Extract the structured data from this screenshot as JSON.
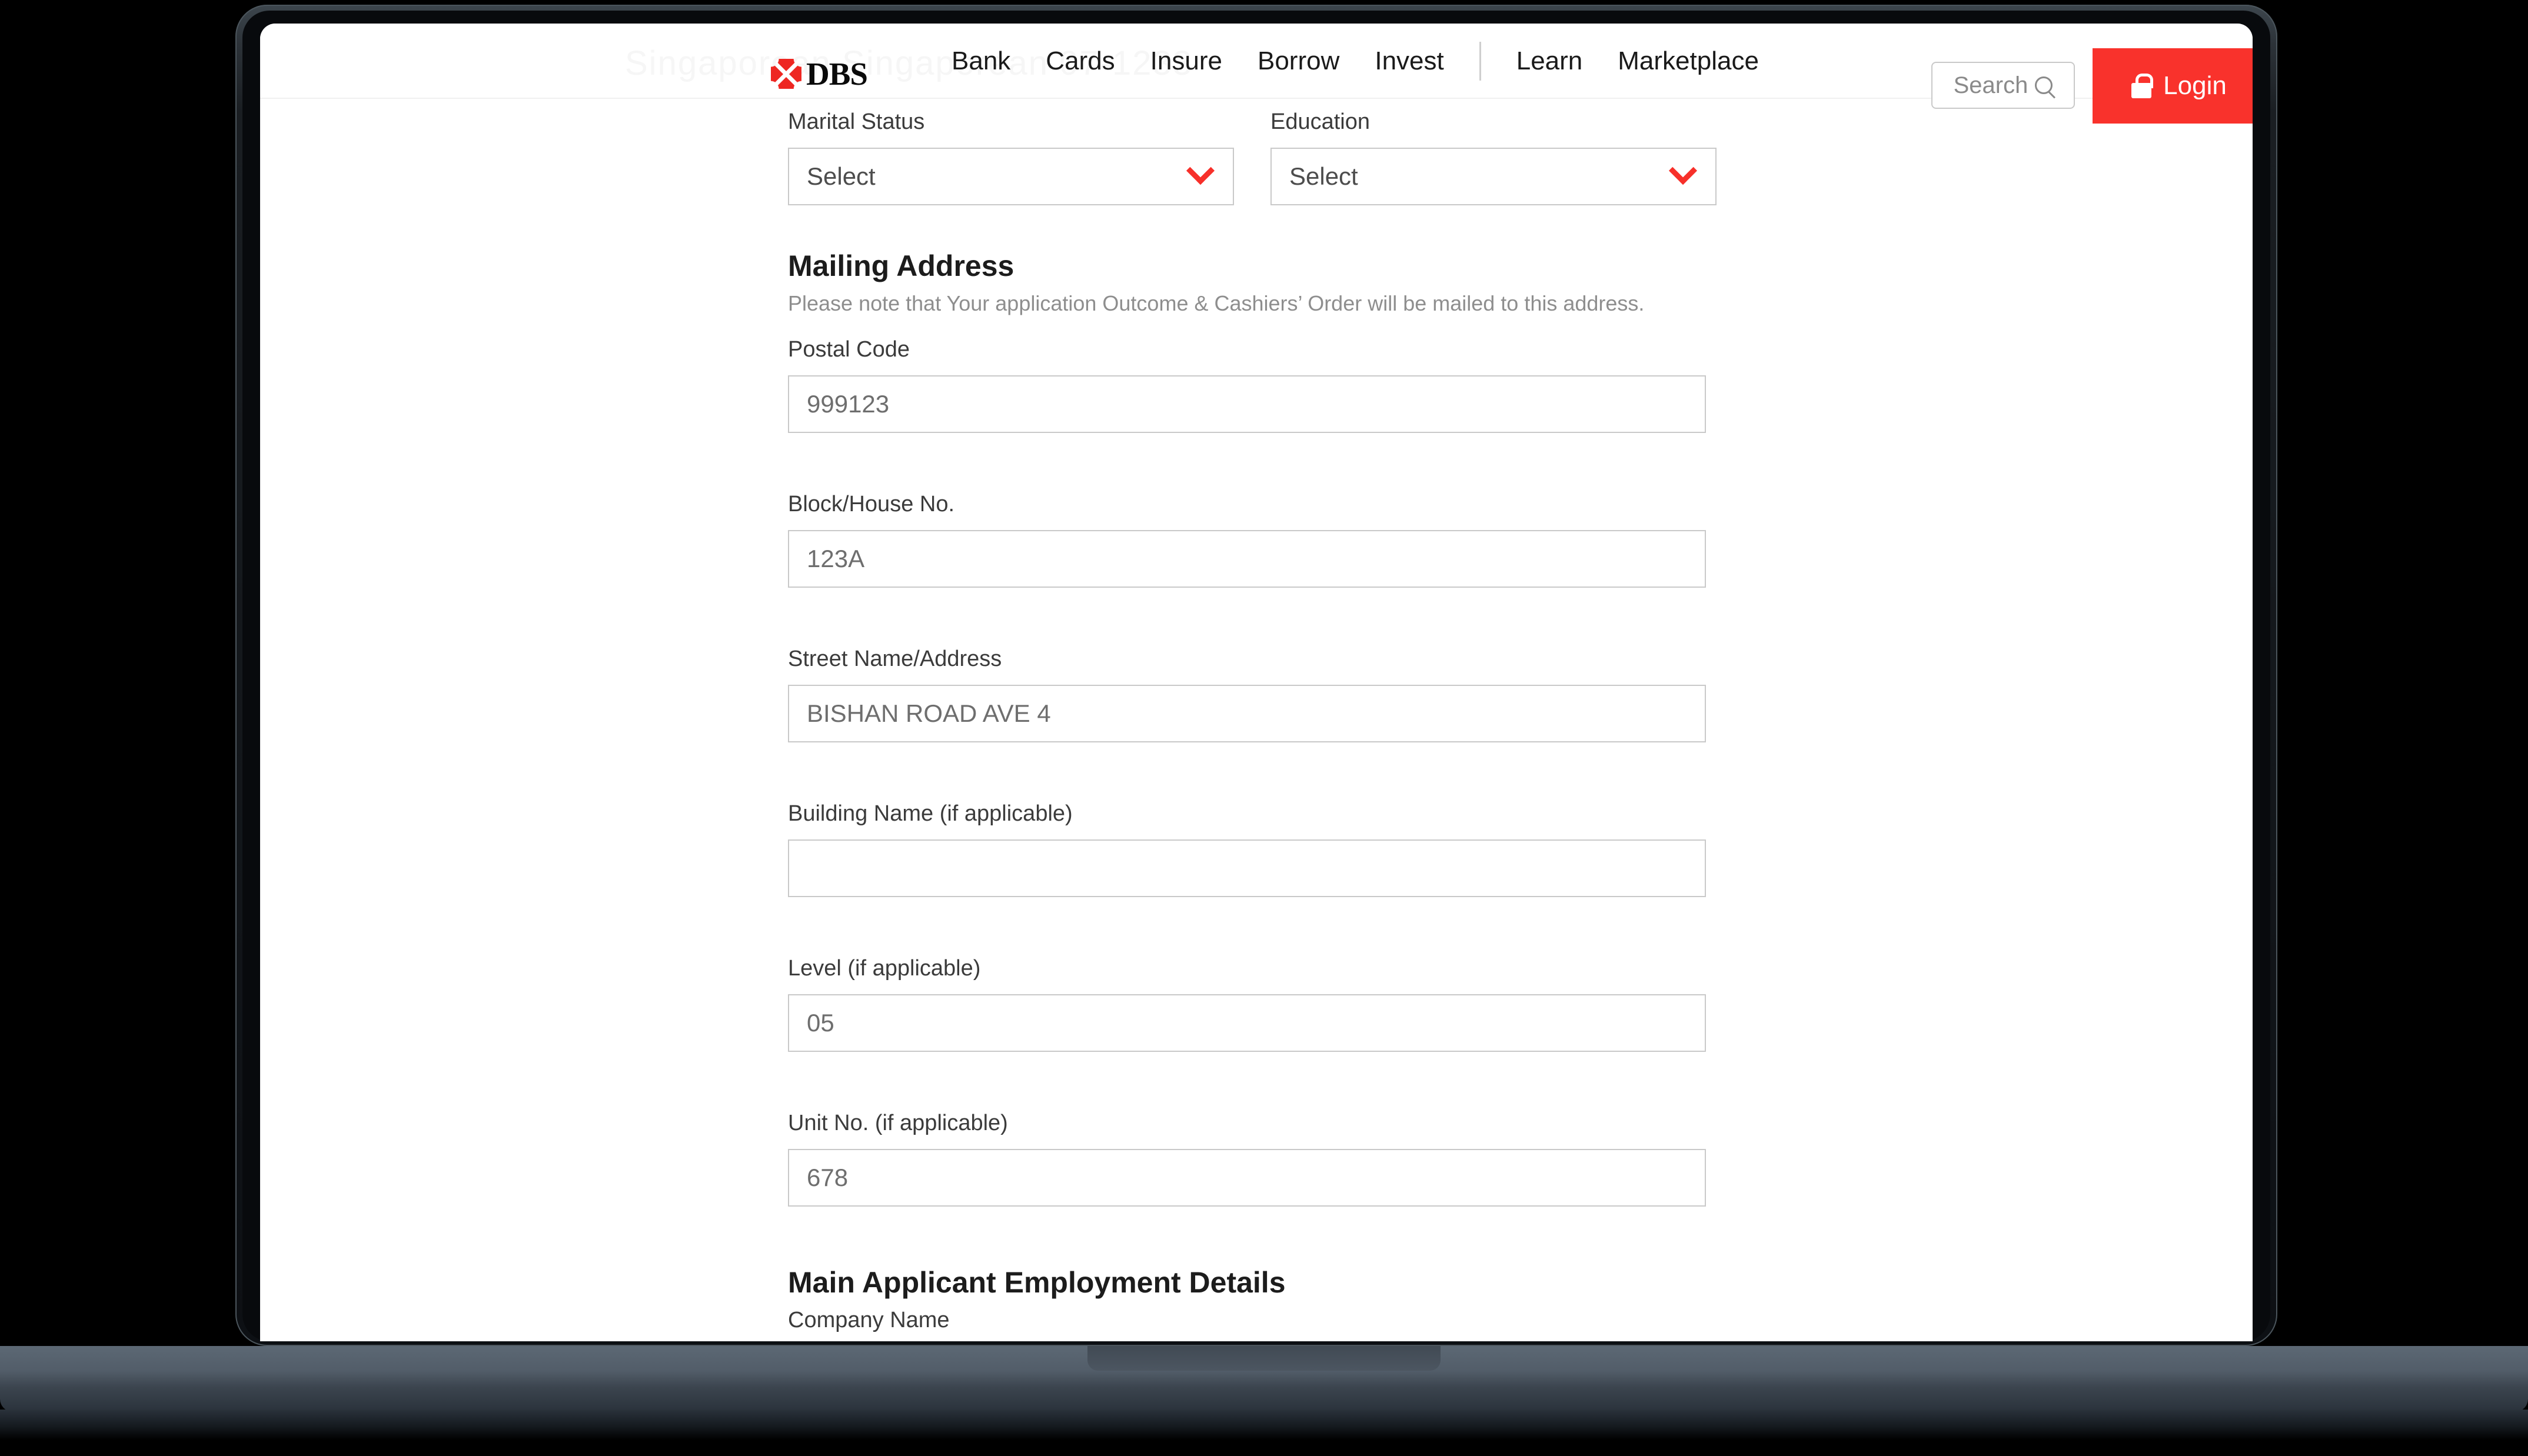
{
  "header": {
    "brand_name": "DBS",
    "watermark_text": "Singaporean    Singaporean    07-1233",
    "nav_items": [
      {
        "label": "Bank"
      },
      {
        "label": "Cards"
      },
      {
        "label": "Insure"
      },
      {
        "label": "Borrow"
      },
      {
        "label": "Invest"
      },
      {
        "label": "Learn"
      },
      {
        "label": "Marketplace"
      }
    ],
    "search": {
      "label": "Search",
      "icon": "search-icon"
    },
    "login": {
      "label": "Login",
      "icon": "lock-icon",
      "color": "#f9322c"
    }
  },
  "form": {
    "marital_status": {
      "label": "Marital Status",
      "value": "Select",
      "icon": "chevron-down-icon"
    },
    "education": {
      "label": "Education",
      "value": "Select",
      "icon": "chevron-down-icon"
    },
    "mailing_address": {
      "heading": "Mailing Address",
      "note": "Please note that Your application Outcome & Cashiers’ Order will be mailed to this address.",
      "postal_code": {
        "label": "Postal Code",
        "value": "999123"
      },
      "block_house_no": {
        "label": "Block/House No.",
        "value": "123A"
      },
      "street_name": {
        "label": "Street Name/Address",
        "value": "BISHAN ROAD AVE 4"
      },
      "building_name": {
        "label": "Building Name (if applicable)",
        "value": ""
      },
      "level": {
        "label": "Level (if applicable)",
        "value": "05"
      },
      "unit_no": {
        "label": "Unit No. (if applicable)",
        "value": "678"
      }
    },
    "employment": {
      "heading": "Main Applicant Employment Details",
      "company_name_label": "Company Name"
    }
  },
  "theme": {
    "brand_red": "#ee2722",
    "accent_red": "#f7302a",
    "login_red": "#f9322c",
    "border_gray": "#c9c9c9",
    "text_dark": "#1c1c1c",
    "text_muted": "#8e8e8e"
  }
}
